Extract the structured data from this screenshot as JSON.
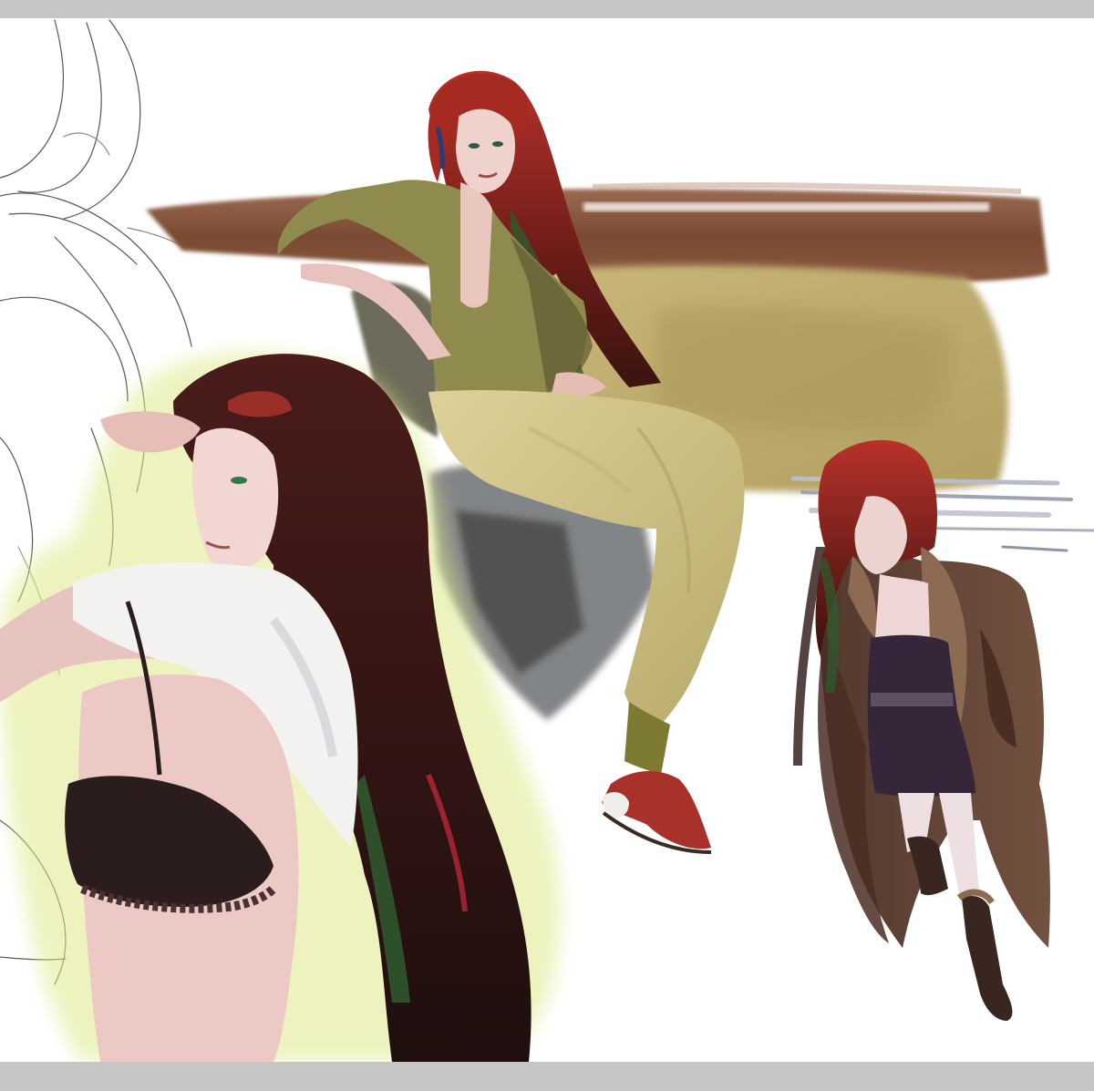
{
  "artwork": {
    "kind": "digital painting sheet",
    "colors": {
      "frame": "#c6c6c6",
      "canvas": "#ffffff",
      "sketch_line": "#4a4a4a",
      "sofa_back": "#7a4a32",
      "sofa_seat": "#bfae72",
      "hair_red": "#8c2a22",
      "hair_dark": "#2a1412",
      "hair_green": "#2f5a2e",
      "skin": "#ecc9c4",
      "shirt_olive": "#8f8a4e",
      "trousers": "#d8cc8a",
      "bra": "#2b1c1d",
      "tshirt": "#f4f2f0",
      "glow_lime": "#dfe98a",
      "coat": "#5a3a2c",
      "fur": "#8d6a52",
      "dress": "#35263a",
      "boots": "#3a2620",
      "shoe_red": "#a8322a"
    }
  }
}
